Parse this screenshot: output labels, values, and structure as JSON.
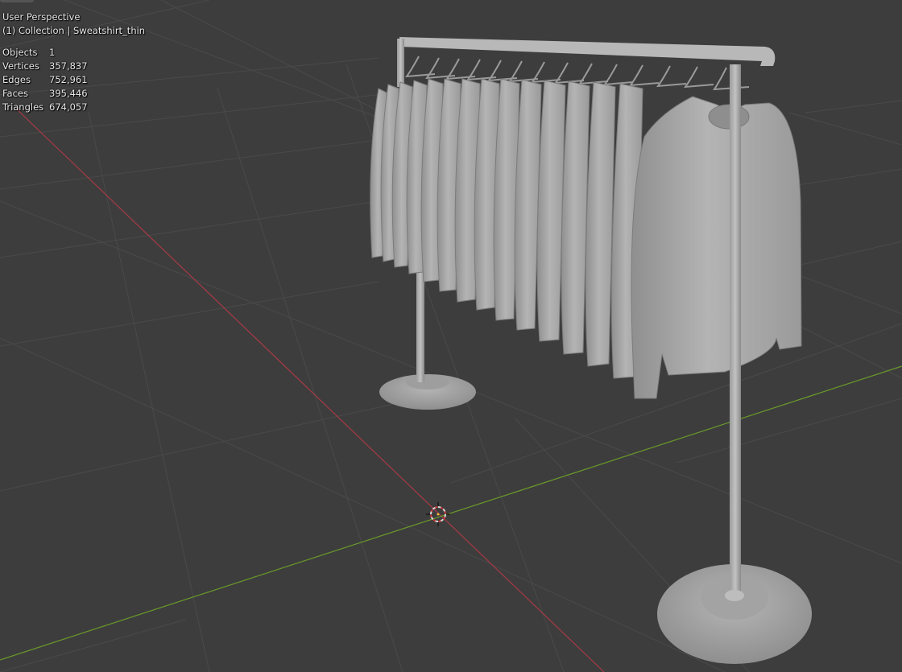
{
  "viewport": {
    "view_name": "User Perspective",
    "collection_info": "(1) Collection | Sweatshirt_thin",
    "stats": [
      {
        "label": "Objects",
        "value": "1"
      },
      {
        "label": "Vertices",
        "value": "357,837"
      },
      {
        "label": "Edges",
        "value": "752,961"
      },
      {
        "label": "Faces",
        "value": "395,446"
      },
      {
        "label": "Triangles",
        "value": "674,057"
      }
    ]
  },
  "colors": {
    "background": "#3d3d3d",
    "grid": "#4a4a4a",
    "x_axis": "#a83a44",
    "y_axis": "#6a9a2a",
    "model": "#a9a9a9"
  }
}
